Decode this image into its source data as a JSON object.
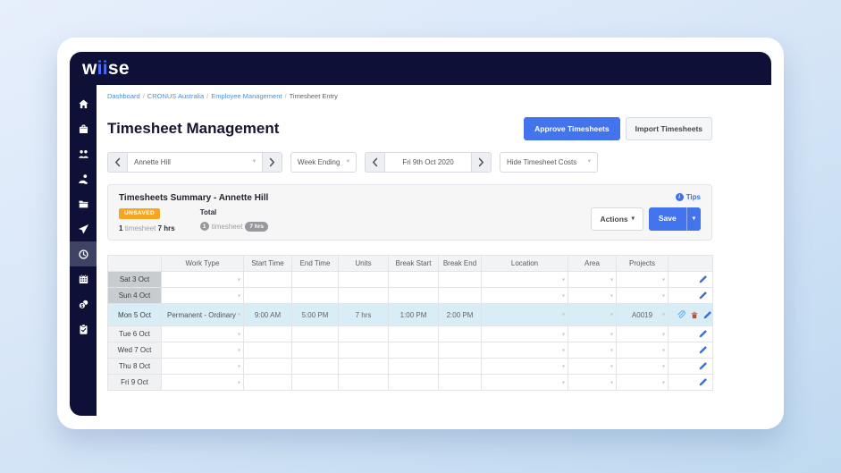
{
  "app": {
    "logo": {
      "w": "w",
      "ii": "ii",
      "se": "se"
    }
  },
  "breadcrumb": {
    "separator": "/",
    "items": [
      {
        "label": "Dashboard"
      },
      {
        "label": "CRONUS Australia"
      },
      {
        "label": "Employee Management"
      },
      {
        "label": "Timesheet Entry"
      }
    ]
  },
  "page": {
    "title": "Timesheet Management",
    "approve_button": "Approve Timesheets",
    "import_button": "Import Timesheets"
  },
  "filters": {
    "employee_value": "Annette Hill",
    "week_ending_label": "Week Ending",
    "week_date_value": "Fri 9th Oct 2020",
    "costs_value": "Hide Timesheet Costs"
  },
  "summary": {
    "title": "Timesheets Summary - Annette Hill",
    "unsaved_badge": "UNSAVED",
    "unsaved_count": "1",
    "unsaved_unit": "timesheet",
    "unsaved_hours": "7 hrs",
    "total_label": "Total",
    "total_count": "1",
    "total_unit": "timesheet",
    "total_hours": "7 hrs",
    "tips_label": "Tips",
    "actions_button": "Actions",
    "save_button": "Save"
  },
  "icons": {
    "caret_down": "▾",
    "info": "i"
  },
  "sidebar": {
    "items": [
      {
        "icon": "home-icon",
        "active": false
      },
      {
        "icon": "briefcase-icon",
        "active": false
      },
      {
        "icon": "employees-icon",
        "active": false
      },
      {
        "icon": "hand-holding-icon",
        "active": false
      },
      {
        "icon": "folder-icon",
        "active": false
      },
      {
        "icon": "plane-icon",
        "active": false
      },
      {
        "icon": "clock-icon",
        "active": true
      },
      {
        "icon": "calendar-icon",
        "active": false
      },
      {
        "icon": "coins-icon",
        "active": false
      },
      {
        "icon": "clipboard-check-icon",
        "active": false
      }
    ]
  },
  "table": {
    "columns": [
      "",
      "Work Type",
      "Start Time",
      "End Time",
      "Units",
      "Break Start",
      "Break End",
      "Location",
      "Area",
      "Projects",
      ""
    ],
    "rows": [
      {
        "day": "Sat 3 Oct",
        "weekend": true,
        "highlight": false,
        "work_type": "",
        "start_time": "",
        "end_time": "",
        "units": "",
        "break_start": "",
        "break_end": "",
        "location": "",
        "area": "",
        "projects": "",
        "attachments": false
      },
      {
        "day": "Sun 4 Oct",
        "weekend": true,
        "highlight": false,
        "work_type": "",
        "start_time": "",
        "end_time": "",
        "units": "",
        "break_start": "",
        "break_end": "",
        "location": "",
        "area": "",
        "projects": "",
        "attachments": false
      },
      {
        "day": "Mon 5 Oct",
        "weekend": false,
        "highlight": true,
        "work_type": "Permanent - Ordinary",
        "start_time": "9:00 AM",
        "end_time": "5:00 PM",
        "units": "7 hrs",
        "break_start": "1:00 PM",
        "break_end": "2:00 PM",
        "location": "",
        "area": "",
        "projects": "A0019",
        "attachments": true
      },
      {
        "day": "Tue 6 Oct",
        "weekend": false,
        "highlight": false,
        "work_type": "",
        "start_time": "",
        "end_time": "",
        "units": "",
        "break_start": "",
        "break_end": "",
        "location": "",
        "area": "",
        "projects": "",
        "attachments": false
      },
      {
        "day": "Wed 7 Oct",
        "weekend": false,
        "highlight": false,
        "work_type": "",
        "start_time": "",
        "end_time": "",
        "units": "",
        "break_start": "",
        "break_end": "",
        "location": "",
        "area": "",
        "projects": "",
        "attachments": false
      },
      {
        "day": "Thu 8 Oct",
        "weekend": false,
        "highlight": false,
        "work_type": "",
        "start_time": "",
        "end_time": "",
        "units": "",
        "break_start": "",
        "break_end": "",
        "location": "",
        "area": "",
        "projects": "",
        "attachments": false
      },
      {
        "day": "Fri 9 Oct",
        "weekend": false,
        "highlight": false,
        "work_type": "",
        "start_time": "",
        "end_time": "",
        "units": "",
        "break_start": "",
        "break_end": "",
        "location": "",
        "area": "",
        "projects": "",
        "attachments": false
      }
    ]
  },
  "colors": {
    "navy": "#0e1038",
    "accent_blue": "#4374ee",
    "link_blue": "#4a90d9",
    "unsaved_orange": "#f5a623",
    "highlight_row": "#d9edf6",
    "weekend_gray": "#c9cccf"
  }
}
